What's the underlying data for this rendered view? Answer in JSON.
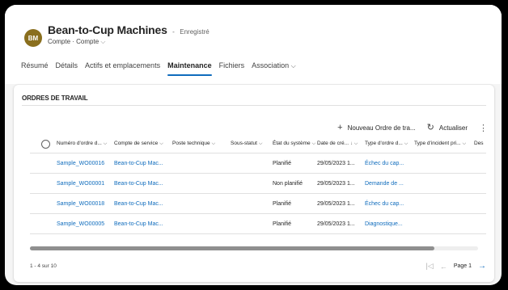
{
  "record": {
    "initials": "BM",
    "title": "Bean-to-Cup Machines",
    "separator": "-",
    "save_status": "Enregistré",
    "entity": "Compte",
    "form_separator": "·",
    "form_name": "Compte",
    "form_chevron": "⌵"
  },
  "tabs": [
    {
      "label": "Résumé"
    },
    {
      "label": "Détails"
    },
    {
      "label": "Actifs et emplacements"
    },
    {
      "label": "Maintenance",
      "active": true
    },
    {
      "label": "Fichiers"
    },
    {
      "label": "Association",
      "chevron": "⌵"
    }
  ],
  "section": {
    "title": "ORDRES DE TRAVAIL"
  },
  "commands": {
    "new_icon": "+",
    "new_label": "Nouveau Ordre de tra...",
    "refresh_icon": "↻",
    "refresh_label": "Actualiser",
    "more_icon": "⋮"
  },
  "columns": [
    {
      "label": "Numéro d'ordre d...",
      "chevron": "⌵"
    },
    {
      "label": "Compte de service",
      "chevron": "⌵"
    },
    {
      "label": "Poste technique",
      "chevron": "⌵"
    },
    {
      "label": "Sous-statut",
      "chevron": "⌵"
    },
    {
      "label": "État du système",
      "chevron": "⌵"
    },
    {
      "label": "Date de cré...",
      "chevron": "↓ ⌵"
    },
    {
      "label": "Type d'ordre d...",
      "chevron": "⌵"
    },
    {
      "label": "Type d'incident pri...",
      "chevron": "⌵"
    },
    {
      "label": "Des",
      "chevron": ""
    }
  ],
  "rows": [
    {
      "number": "Sample_WO00016",
      "account": "Bean-to-Cup Mac...",
      "status": "Planifié",
      "date": "29/05/2023 1...",
      "type": "Échec du cap..."
    },
    {
      "number": "Sample_WO00001",
      "account": "Bean-to-Cup Mac...",
      "status": "Non planifié",
      "date": "29/05/2023 1...",
      "type": "Demande de ..."
    },
    {
      "number": "Sample_WO00018",
      "account": "Bean-to-Cup Mac...",
      "status": "Planifié",
      "date": "29/05/2023 1...",
      "type": "Échec du cap..."
    },
    {
      "number": "Sample_WO00005",
      "account": "Bean-to-Cup Mac...",
      "status": "Planifié",
      "date": "29/05/2023 1...",
      "type": "Diagnostique..."
    }
  ],
  "footer": {
    "count": "1 - 4 sur 10",
    "first_icon": "|◁",
    "prev_icon": "←",
    "page": "Page 1",
    "next_icon": "→"
  },
  "colors": {
    "accent": "#0f6cbd",
    "avatar": "#8a6f1e",
    "link": "#0f6cbd"
  }
}
